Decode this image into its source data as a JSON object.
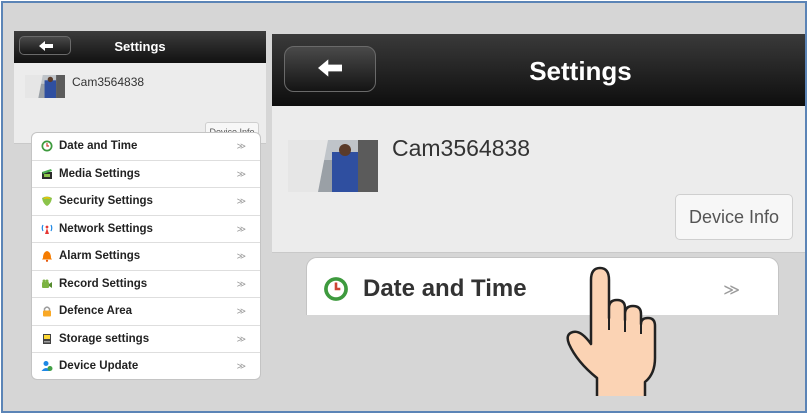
{
  "small_panel": {
    "title": "Settings",
    "camera_name": "Cam3564838",
    "device_info_label": "Device Info",
    "menu": [
      {
        "label": "Date and Time",
        "icon": "clock-icon",
        "chevron": "≫"
      },
      {
        "label": "Media Settings",
        "icon": "media-icon",
        "chevron": "≫"
      },
      {
        "label": "Security Settings",
        "icon": "shield-icon",
        "chevron": "≫"
      },
      {
        "label": "Network Settings",
        "icon": "antenna-icon",
        "chevron": "≫"
      },
      {
        "label": "Alarm Settings",
        "icon": "bell-icon",
        "chevron": "≫"
      },
      {
        "label": "Record Settings",
        "icon": "camcorder-icon",
        "chevron": "≫"
      },
      {
        "label": "Defence Area",
        "icon": "lock-icon",
        "chevron": "≫"
      },
      {
        "label": "Storage settings",
        "icon": "storage-icon",
        "chevron": "≫"
      },
      {
        "label": "Device Update",
        "icon": "user-update-icon",
        "chevron": "≫"
      }
    ]
  },
  "zoom_panel": {
    "title": "Settings",
    "camera_name": "Cam3564838",
    "device_info_label": "Device Info",
    "menu": [
      {
        "label": "Date and Time",
        "icon": "clock-icon",
        "chevron": "≫"
      }
    ]
  },
  "overlay": {
    "icon": "pointing-hand-icon"
  },
  "colors": {
    "frame_border": "#5b84b6",
    "header_dark": "#111111",
    "background": "#d6d6d6",
    "hand_skin": "#fbd3b4"
  }
}
